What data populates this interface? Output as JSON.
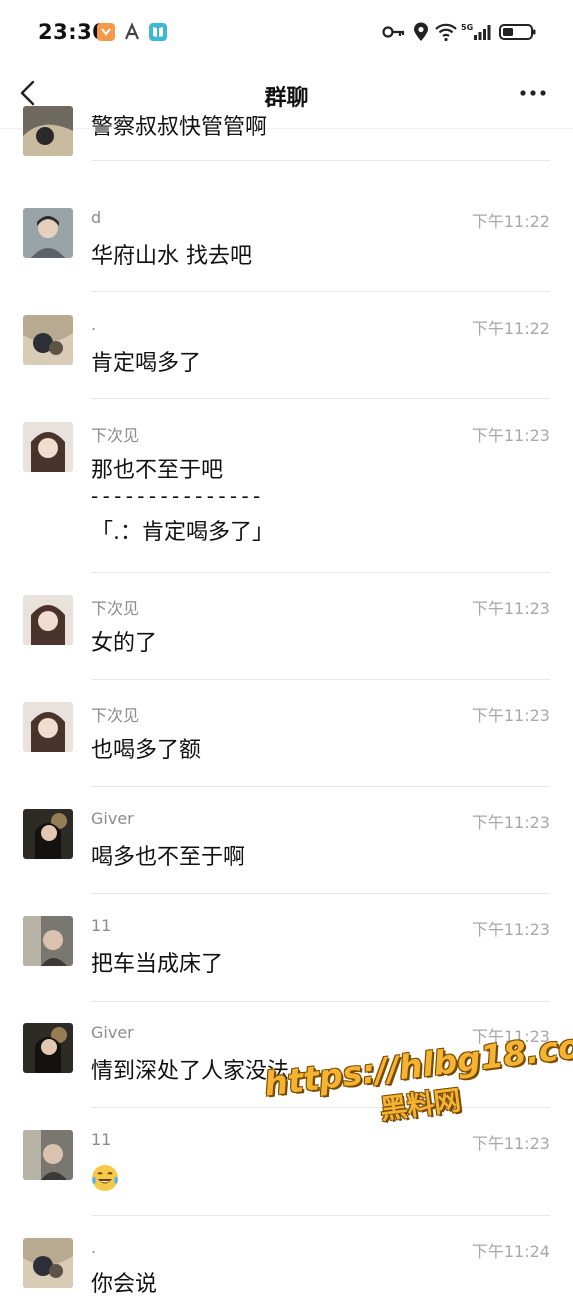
{
  "status_bar": {
    "time": "23:30",
    "icons": [
      "shield-app-icon",
      "a-app-icon",
      "book-app-icon",
      "key-icon",
      "location-icon",
      "wifi-icon",
      "signal-5g-icon",
      "battery-icon"
    ],
    "network": "5G"
  },
  "nav": {
    "title": "群聊",
    "back_icon": "chevron-left-icon",
    "more_icon": "more-dots-icon"
  },
  "messages": [
    {
      "sender": "",
      "time": "",
      "text": "警察叔叔快管管啊",
      "avatar": "avatar-dot"
    },
    {
      "sender": "d",
      "time": "下午11:22",
      "text": "华府山水 找去吧",
      "avatar": "avatar-d"
    },
    {
      "sender": ".",
      "time": "下午11:22",
      "text": "肯定喝多了",
      "avatar": "avatar-dot"
    },
    {
      "sender": "下次见",
      "time": "下午11:23",
      "text": "那也不至于吧",
      "quote_sep": "- - - - - - - - - - - - - - -",
      "quote": "「.：肯定喝多了」",
      "avatar": "avatar-xiacijian"
    },
    {
      "sender": "下次见",
      "time": "下午11:23",
      "text": "女的了",
      "avatar": "avatar-xiacijian"
    },
    {
      "sender": "下次见",
      "time": "下午11:23",
      "text": "也喝多了额",
      "avatar": "avatar-xiacijian"
    },
    {
      "sender": "Giver",
      "time": "下午11:23",
      "text": "喝多也不至于啊",
      "avatar": "avatar-giver"
    },
    {
      "sender": "11",
      "time": "下午11:23",
      "text": "把车当成床了",
      "avatar": "avatar-11"
    },
    {
      "sender": "Giver",
      "time": "下午11:23",
      "text": "情到深处了人家没法",
      "avatar": "avatar-giver"
    },
    {
      "sender": "11",
      "time": "下午11:23",
      "text": "",
      "emoji": "laughing-tears-emoji",
      "avatar": "avatar-11"
    },
    {
      "sender": ".",
      "time": "下午11:24",
      "text": "你会说",
      "avatar": "avatar-dot"
    }
  ],
  "watermark": {
    "url": "https://hlbg18.com",
    "cn": "黑料网"
  },
  "colors": {
    "background": "#ffffff",
    "text_primary": "#111111",
    "text_secondary": "#8c8c8c",
    "time_text": "#a8a8a8",
    "divider": "#e8e8e8",
    "watermark_fill": "#f4b330"
  }
}
